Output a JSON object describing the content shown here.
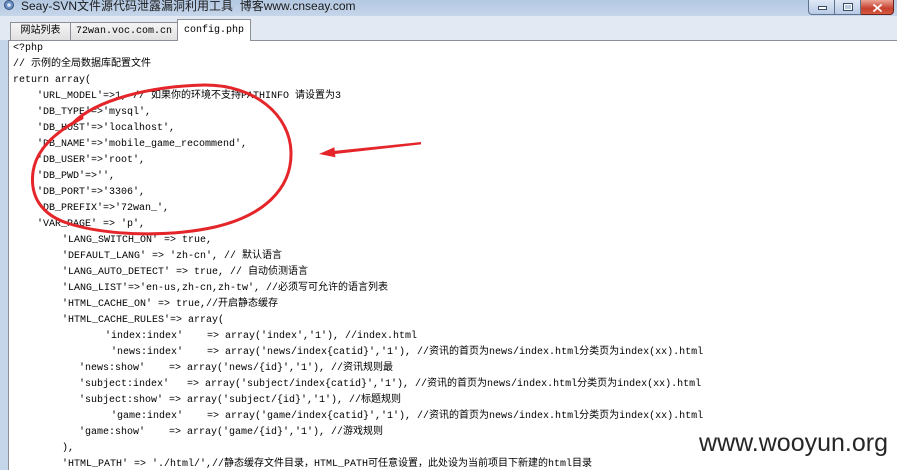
{
  "window": {
    "title": "Seay-SVN文件源代码泄露漏洞利用工具  博客www.cnseay.com"
  },
  "icons": {
    "app": "app-icon",
    "minimize": "minimize-icon",
    "maximize": "maximize-icon",
    "close": "close-icon"
  },
  "tabs": [
    {
      "label": "网站列表",
      "active": false
    },
    {
      "label": "72wan.voc.com.cn",
      "active": false
    },
    {
      "label": "config.php",
      "active": true
    }
  ],
  "editor": {
    "lines": [
      "<?php",
      "// 示例的全局数据库配置文件",
      "return array(",
      "'URL_MODEL'=>1, // 如果你的环境不支持PATHINFO 请设置为3",
      "'DB_TYPE'=>'mysql',",
      "'DB_HOST'=>'localhost',",
      "'DB_NAME'=>'mobile_game_recommend',",
      "'DB_USER'=>'root',",
      "'DB_PWD'=>'',",
      "'DB_PORT'=>'3306',",
      "'DB_PREFIX'=>'72wan_',",
      "'VAR_PAGE' => 'p',",
      "'LANG_SWITCH_ON' => true,",
      "'DEFAULT_LANG' => 'zh-cn', // 默认语言",
      "'LANG_AUTO_DETECT' => true, // 自动侦测语言",
      "'LANG_LIST'=>'en-us,zh-cn,zh-tw', //必须写可允许的语言列表",
      "'HTML_CACHE_ON' => true,//开启静态缓存",
      "'HTML_CACHE_RULES'=> array(",
      "'index:index'    => array('index','1'), //index.html",
      "'news:index'    => array('news/index{catid}','1'), //资讯的首页为news/index.html分类页为index(xx).html",
      "'news:show'    => array('news/{id}','1'), //资讯规则最",
      "'subject:index'   => array('subject/index{catid}','1'), //资讯的首页为news/index.html分类页为index(xx).html",
      "'subject:show' => array('subject/{id}','1'), //标题规则",
      "'game:index'    => array('game/index{catid}','1'), //资讯的首页为news/index.html分类页为index(xx).html",
      "'game:show'    => array('game/{id}','1'), //游戏规则",
      "),",
      "'HTML_PATH' => './html/',//静态缓存文件目录，HTML_PATH可任意设置，此处设为当前项目下新建的html目录"
    ]
  },
  "watermark": {
    "text": "www.wooyun.org"
  },
  "colors": {
    "annotation": "#e4262a",
    "close_button": "#c7412f",
    "window_frame": "#c6d6ea",
    "active_tab": "#ffffff"
  }
}
